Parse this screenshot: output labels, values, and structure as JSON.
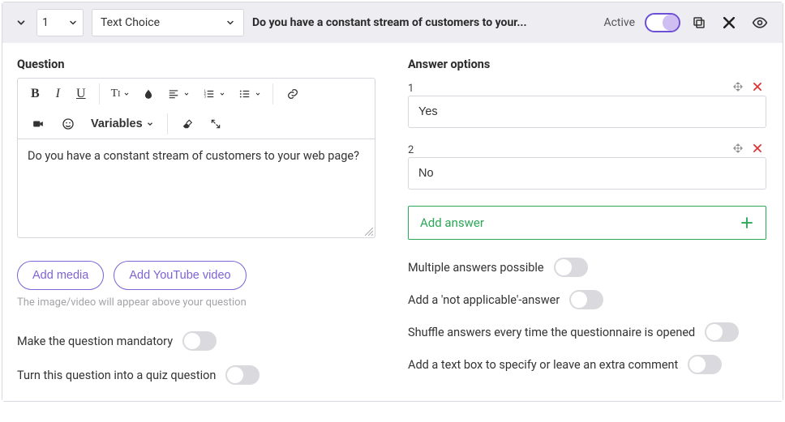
{
  "header": {
    "question_number": "1",
    "question_type": "Text Choice",
    "question_preview": "Do you have a constant stream of customers to your...",
    "active_label": "Active",
    "active_state": true
  },
  "question": {
    "section_title": "Question",
    "variables_label": "Variables",
    "text": "Do you have a constant stream of customers to your web page?",
    "add_media_label": "Add media",
    "add_youtube_label": "Add YouTube video",
    "media_hint": "The image/video will appear above your question",
    "mandatory_label": "Make the question mandatory",
    "mandatory_state": false,
    "quiz_label": "Turn this question into a quiz question",
    "quiz_state": false
  },
  "answers": {
    "section_title": "Answer options",
    "options": [
      {
        "num": "1",
        "value": "Yes"
      },
      {
        "num": "2",
        "value": "No"
      }
    ],
    "add_answer_label": "Add answer",
    "multiple_label": "Multiple answers possible",
    "multiple_state": false,
    "na_label": "Add a 'not applicable'-answer",
    "na_state": false,
    "shuffle_label": "Shuffle answers every time the questionnaire is opened",
    "shuffle_state": false,
    "comment_label": "Add a text box to specify or leave an extra comment",
    "comment_state": false
  }
}
